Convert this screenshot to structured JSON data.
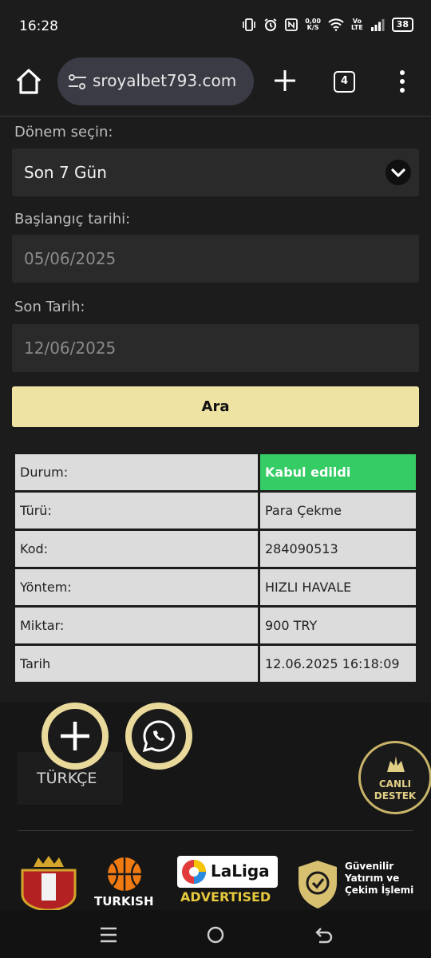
{
  "status_bar": {
    "time": "16:28",
    "net_speed_value": "0,00",
    "net_speed_unit": "K/S",
    "volte_top": "Vo",
    "volte_bottom": "LTE",
    "battery": "38"
  },
  "browser": {
    "url": "sroyalbet793.com",
    "tab_count": "4"
  },
  "form": {
    "period_label": "Dönem seçin:",
    "period_value": "Son 7 Gün",
    "start_label": "Başlangıç tarihi:",
    "start_value": "05/06/2025",
    "end_label": "Son Tarih:",
    "end_value": "12/06/2025",
    "search_button": "Ara"
  },
  "details": [
    {
      "key": "Durum:",
      "value": "Kabul edildi"
    },
    {
      "key": "Türü:",
      "value": "Para Çekme"
    },
    {
      "key": "Kod:",
      "value": "284090513"
    },
    {
      "key": "Yöntem:",
      "value": "HIZLI HAVALE"
    },
    {
      "key": "Miktar:",
      "value": "900 TRY"
    },
    {
      "key": "Tarih",
      "value": "12.06.2025 16:18:09"
    }
  ],
  "footer": {
    "language": "TÜRKÇE",
    "live_support_line1": "CANLI",
    "live_support_line2": "DESTEK",
    "sponsor_turkish": "TURKISH",
    "sponsor_laliga": "LaLiga",
    "sponsor_advertised": "ADVERTISED",
    "trust_line1": "Güvenilir",
    "trust_line2": "Yatırım ve",
    "trust_line3": "Çekim İşlemi"
  },
  "colors": {
    "accent_gold": "#efe3a3",
    "accepted_green": "#36cc65",
    "cell_bg": "#dcdcdc"
  }
}
